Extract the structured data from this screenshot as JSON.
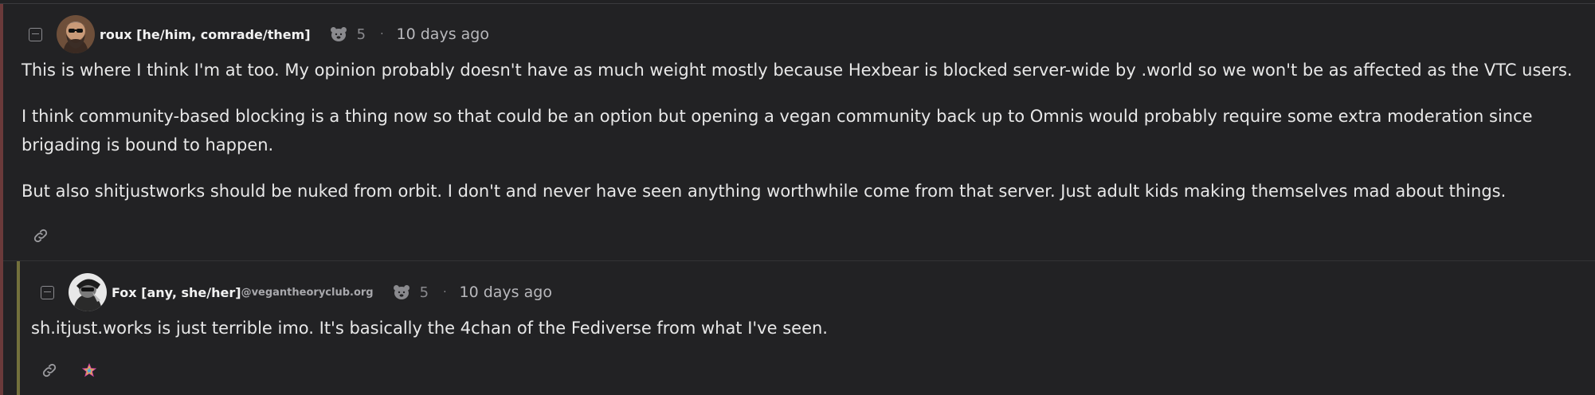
{
  "comments": [
    {
      "username": "roux [he/him, comrade/them]",
      "instance": "",
      "score": "5",
      "separator": "·",
      "time": "10 days ago",
      "paragraphs": [
        "This is where I think I'm at too. My opinion probably doesn't have as much weight mostly because Hexbear is blocked server-wide by .world so we won't be as affected as the VTC users.",
        "I think community-based blocking is a thing now so that could be an option but opening a vegan community back up to Omnis would probably require some extra moderation since",
        "brigading is bound to happen.",
        "But also shitjustworks should be nuked from orbit. I don't and never have seen anything worthwhile come from that server. Just adult kids making themselves mad about things."
      ]
    },
    {
      "username": "Fox [any, she/her]",
      "instance": "@vegantheoryclub.org",
      "score": "5",
      "separator": "·",
      "time": "10 days ago",
      "paragraphs": [
        "sh.itjust.works is just terrible imo. It's basically the 4chan of the Fediverse from what I've seen."
      ]
    }
  ],
  "icons": {
    "collapse": "minus-square-icon",
    "score": "bear-icon",
    "link": "link-icon",
    "emoji": "star-icon"
  },
  "colors": {
    "background": "#222224",
    "thread_bar_1": "#6b3a3a",
    "thread_bar_2": "#73703c",
    "text": "#e8e8e8",
    "muted": "#8a8a8e"
  }
}
